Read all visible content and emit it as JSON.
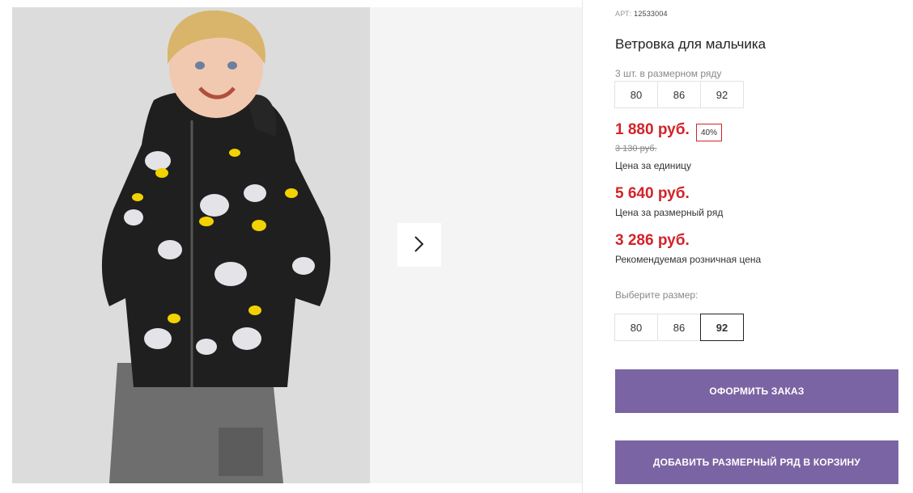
{
  "product": {
    "sku_label": "АРТ:",
    "sku_value": "12533004",
    "title": "Ветровка для мальчика",
    "pack_label": "3 шт. в размерном ряду",
    "pack_sizes": [
      "80",
      "86",
      "92"
    ],
    "price_unit": "1 880 руб.",
    "discount_badge": "40%",
    "old_price": "3 130 руб.",
    "price_unit_caption": "Цена за единицу",
    "price_pack": "5 640 руб.",
    "price_pack_caption": "Цена за размерный ряд",
    "price_retail": "3 286 руб.",
    "price_retail_caption": "Рекомендуемая розничная цена",
    "choose_size_label": "Выберите размер:",
    "size_options": [
      "80",
      "86",
      "92"
    ],
    "selected_size": "92"
  },
  "actions": {
    "order_label": "Оформить заказ",
    "add_pack_label": "Добавить размерный ряд в корзину"
  },
  "colors": {
    "accent_button": "#7b64a3",
    "price_red": "#d2232a"
  },
  "icons": {
    "next": "chevron-right-icon"
  }
}
